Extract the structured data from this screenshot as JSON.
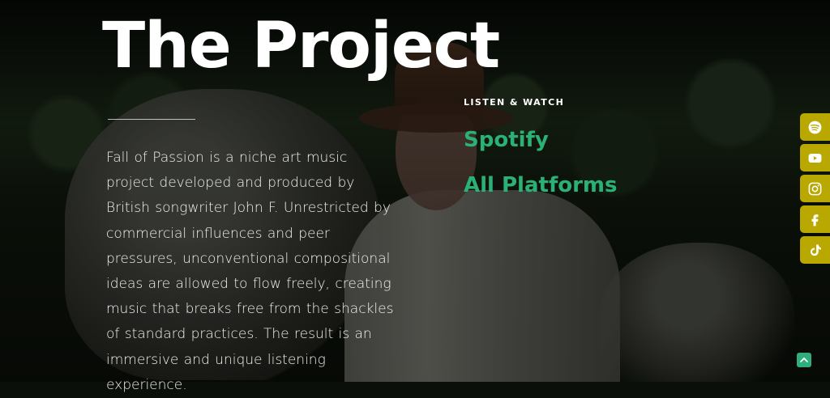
{
  "page": {
    "title": "The Project",
    "description": "Fall of Passion is a niche art music project developed and produced by British songwriter John F.  Unrestricted by commercial influences and peer pressures, unconventional compositional ideas are allowed to flow freely, creating music that breaks free from the shackles of standard practices.  The result is an immersive and unique listening experience."
  },
  "listen": {
    "label": "LISTEN & WATCH",
    "links": [
      "Spotify",
      "All Platforms"
    ]
  },
  "social": {
    "icons": [
      "spotify-icon",
      "youtube-icon",
      "instagram-icon",
      "facebook-icon",
      "tiktok-icon"
    ],
    "accent": "#b9a800"
  },
  "colors": {
    "link": "#2bb176",
    "scroll_button": "#2fad7a"
  }
}
